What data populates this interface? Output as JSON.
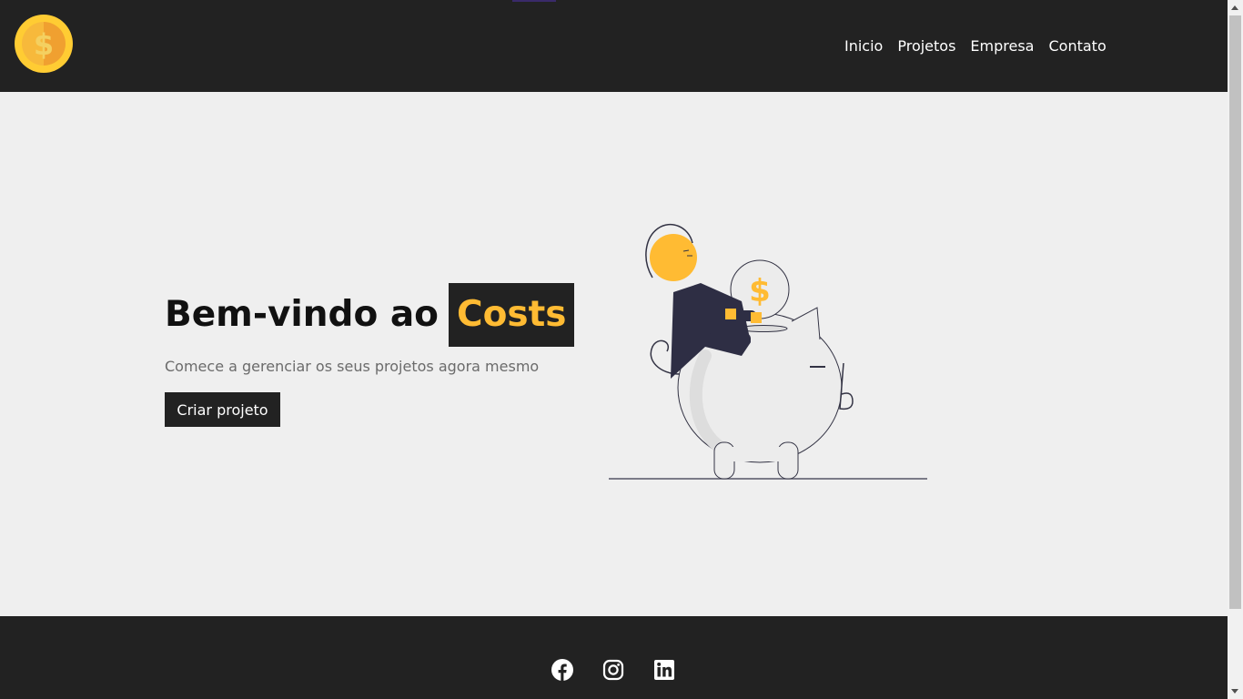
{
  "header": {
    "logo_icon": "coin-dollar-icon",
    "nav": [
      {
        "label": "Inicio"
      },
      {
        "label": "Projetos"
      },
      {
        "label": "Empresa"
      },
      {
        "label": "Contato"
      }
    ]
  },
  "hero": {
    "title_prefix": "Bem-vindo ao",
    "title_brand": "Costs",
    "subtitle": "Comece a gerenciar os seus projetos agora mesmo",
    "cta_label": "Criar projeto",
    "illustration_icon": "piggy-bank-savings-illustration",
    "illustration_coin_symbol": "$"
  },
  "footer": {
    "social": [
      {
        "icon": "facebook-icon"
      },
      {
        "icon": "instagram-icon"
      },
      {
        "icon": "linkedin-icon"
      }
    ]
  },
  "colors": {
    "dark": "#222222",
    "accent": "#ffbb33",
    "background": "#efefef",
    "text_muted": "#6b6b6b"
  }
}
